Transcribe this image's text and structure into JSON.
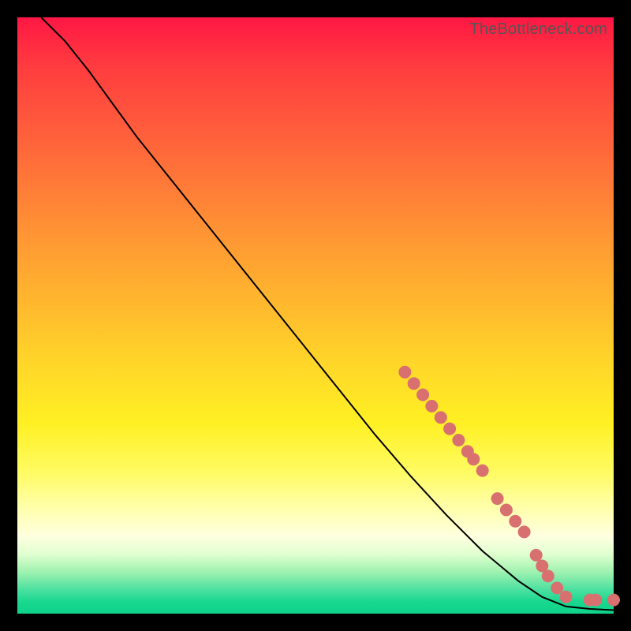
{
  "watermark": "TheBottleneck.com",
  "chart_data": {
    "type": "line",
    "title": "",
    "xlabel": "",
    "ylabel": "",
    "xlim": [
      0,
      100
    ],
    "ylim": [
      0,
      100
    ],
    "curve": [
      {
        "x": 4,
        "y": 100
      },
      {
        "x": 8,
        "y": 96
      },
      {
        "x": 12,
        "y": 91
      },
      {
        "x": 20,
        "y": 80
      },
      {
        "x": 30,
        "y": 67.5
      },
      {
        "x": 40,
        "y": 55
      },
      {
        "x": 50,
        "y": 42.5
      },
      {
        "x": 60,
        "y": 30
      },
      {
        "x": 66,
        "y": 23
      },
      {
        "x": 72,
        "y": 16.5
      },
      {
        "x": 78,
        "y": 10.5
      },
      {
        "x": 84,
        "y": 5.5
      },
      {
        "x": 88,
        "y": 2.8
      },
      {
        "x": 92,
        "y": 1.2
      },
      {
        "x": 96,
        "y": 0.8
      },
      {
        "x": 100,
        "y": 0.6
      }
    ],
    "points": [
      {
        "x": 65.0,
        "y": 40.5
      },
      {
        "x": 66.5,
        "y": 38.6
      },
      {
        "x": 68.0,
        "y": 36.7
      },
      {
        "x": 69.5,
        "y": 34.8
      },
      {
        "x": 71.0,
        "y": 32.9
      },
      {
        "x": 72.5,
        "y": 31.0
      },
      {
        "x": 74.0,
        "y": 29.1
      },
      {
        "x": 75.5,
        "y": 27.2
      },
      {
        "x": 76.5,
        "y": 25.9
      },
      {
        "x": 78.0,
        "y": 24.0
      },
      {
        "x": 80.5,
        "y": 19.3
      },
      {
        "x": 82.0,
        "y": 17.4
      },
      {
        "x": 83.5,
        "y": 15.5
      },
      {
        "x": 85.0,
        "y": 13.7
      },
      {
        "x": 87.0,
        "y": 9.8
      },
      {
        "x": 88.0,
        "y": 8.0
      },
      {
        "x": 89.0,
        "y": 6.3
      },
      {
        "x": 90.5,
        "y": 4.3
      },
      {
        "x": 92.0,
        "y": 2.8
      },
      {
        "x": 96.0,
        "y": 2.3
      },
      {
        "x": 97.0,
        "y": 2.3
      },
      {
        "x": 100.0,
        "y": 2.3
      }
    ],
    "point_color": "#d97070",
    "point_radius_px": 8,
    "line_color": "#000000"
  }
}
